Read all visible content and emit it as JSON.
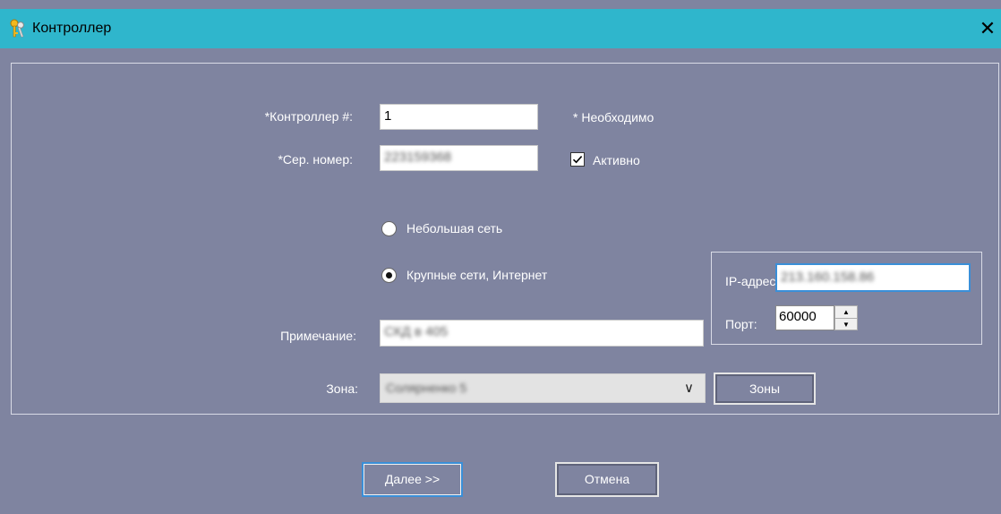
{
  "window": {
    "title": "Контроллер"
  },
  "form": {
    "controller_label": "*Контроллер #:",
    "controller_value": "1",
    "required_note": "* Необходимо",
    "serial_label": "*Сер. номер:",
    "serial_value": "223159368",
    "active_label": "Активно",
    "active_checked": true,
    "small_network_label": "Небольшая сеть",
    "large_network_label": "Крупные сети, Интернет",
    "selected_network": "large",
    "ip_label": "IP-адрес",
    "ip_value": "213.160.158.86",
    "port_label": "Порт:",
    "port_value": "60000",
    "note_label": "Примечание:",
    "note_value": "СКД в 405",
    "zone_label": "Зона:",
    "zone_value": "Солярненко 5",
    "zones_button": "Зоны"
  },
  "footer": {
    "next_button": "Далее >>",
    "cancel_button": "Отмена"
  },
  "colors": {
    "titlebar": "#2fb6cc",
    "dialog_bg": "#7f84a0",
    "focus": "#3a8fd8"
  },
  "icons": {
    "title_icon": "keys-icon",
    "close_icon": "close-icon"
  }
}
